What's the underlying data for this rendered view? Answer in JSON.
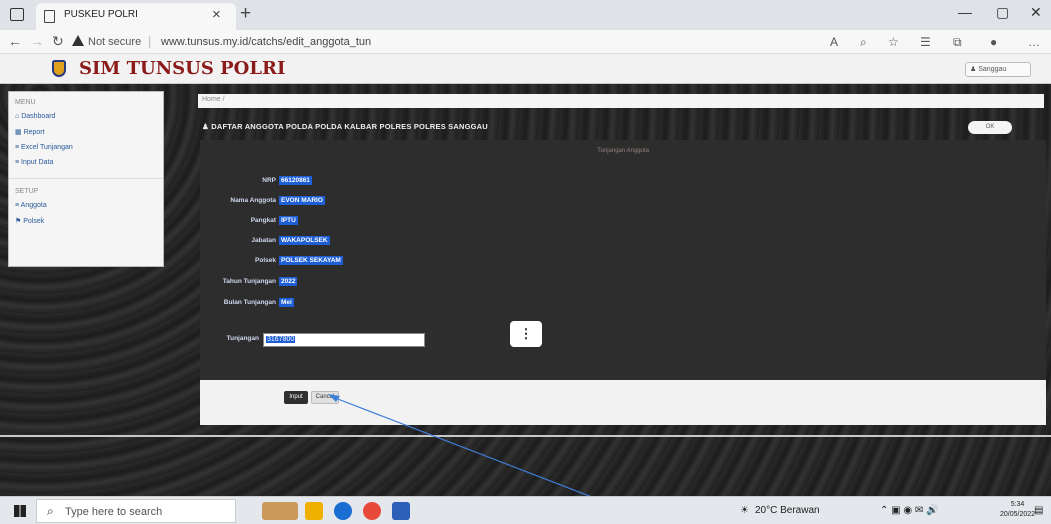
{
  "browser": {
    "tab_title": "PUSKEU POLRI",
    "tab_close": "×",
    "new_tab": "+",
    "security_label": "Not secure",
    "url": "www.tunsus.my.id/catchs/edit_anggota_tun",
    "window_controls": [
      "—",
      "▢",
      "✕"
    ]
  },
  "site": {
    "title": "SIM TUNSUS POLRI",
    "user_button": "Sanggau"
  },
  "sidebar": {
    "menu_heading": "MENU",
    "menu_items": [
      "Dashboard",
      "Report",
      "Excel Tunjangan",
      "Input Data"
    ],
    "setup_heading": "SETUP",
    "setup_items": [
      "Anggota",
      "Polsek"
    ]
  },
  "breadcrumb": "Home /",
  "panel": {
    "title": "DAFTAR ANGGOTA POLDA POLDA KALBAR POLRES POLRES SANGGAU",
    "close_label": "OK",
    "subtitle": "Tunjangan Anggota"
  },
  "fields": [
    {
      "label": "NRP",
      "value": "66120861"
    },
    {
      "label": "Nama Anggota",
      "value": "EVON MARIO"
    },
    {
      "label": "Pangkat",
      "value": "IPTU"
    },
    {
      "label": "Jabatan",
      "value": "WAKAPOLSEK"
    },
    {
      "label": "Polsek",
      "value": "POLSEK SEKAYAM"
    },
    {
      "label": "Tahun Tunjangan",
      "value": "2022"
    },
    {
      "label": "Bulan Tunjangan",
      "value": "Mei"
    }
  ],
  "tunjangan": {
    "label": "Tunjangan",
    "value": "3167800"
  },
  "actions": {
    "submit": "Input",
    "cancel": "Cancel",
    "menu": "⋮"
  },
  "taskbar": {
    "search_placeholder": "Type here to search",
    "weather": "20°C Berawan",
    "time": "5:34",
    "date": "20/05/2022"
  }
}
